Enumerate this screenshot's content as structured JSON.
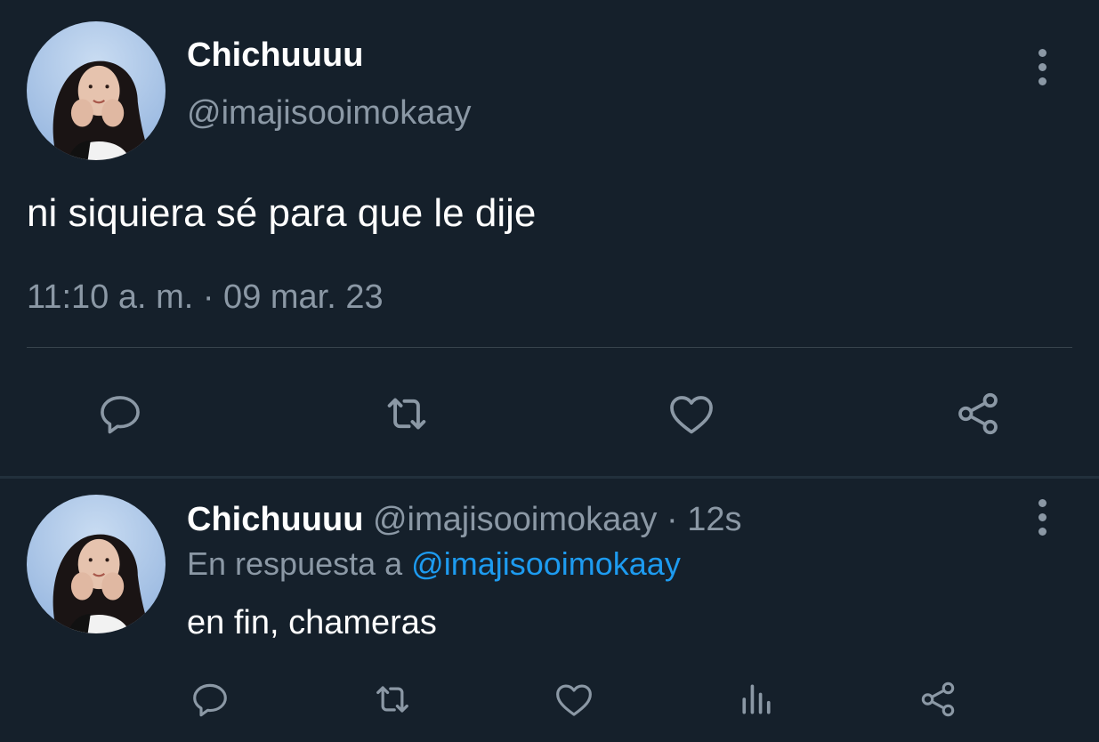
{
  "main_tweet": {
    "display_name": "Chichuuuu",
    "handle": "@imajisooimokaay",
    "text": "ni siquiera sé para que le dije",
    "timestamp": "11:10 a. m. · 09 mar. 23",
    "actions": [
      "reply-icon",
      "retweet-icon",
      "like-icon",
      "share-icon"
    ]
  },
  "reply_tweet": {
    "display_name": "Chichuuuu",
    "handle": "@imajisooimokaay",
    "separator": " · ",
    "age": "12s",
    "reply_prefix": "En respuesta a ",
    "reply_to": "@imajisooimokaay",
    "text": "en fin, chameras",
    "actions": [
      "reply-icon",
      "retweet-icon",
      "like-icon",
      "analytics-icon",
      "share-icon"
    ]
  },
  "colors": {
    "background": "#15202b",
    "text_primary": "#ffffff",
    "text_muted": "#8b98a5",
    "link": "#1d9bf0",
    "divider": "#38444d"
  }
}
